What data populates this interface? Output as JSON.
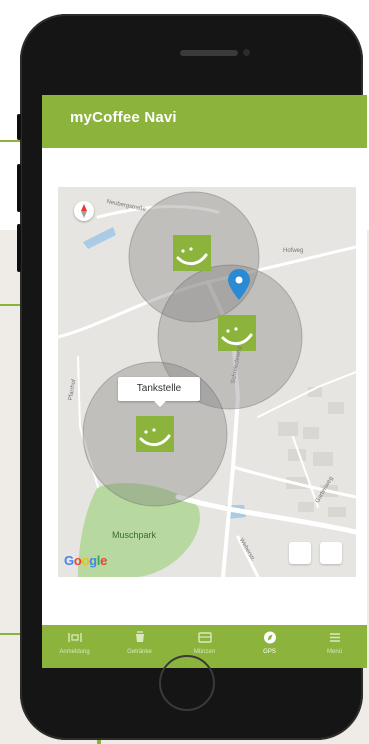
{
  "app": {
    "title": "myCoffee Navi"
  },
  "map": {
    "marker_label": "Tankstelle",
    "park_label": "Muschpark",
    "google_logo": [
      "G",
      "o",
      "o",
      "g",
      "l",
      "e"
    ],
    "google_colors": [
      "#4285f4",
      "#ea4335",
      "#fbbc05",
      "#4285f4",
      "#34a853",
      "#ea4335"
    ],
    "streets": [
      "Neubergstraße",
      "Hofweg",
      "Pfarrhof",
      "Schmiedeweg",
      "Gartenweg",
      "Weberstr."
    ]
  },
  "nav": {
    "items": [
      {
        "label": "Anmeldung",
        "icon": "id-card-icon",
        "active": false
      },
      {
        "label": "Getränke",
        "icon": "cup-icon",
        "active": false
      },
      {
        "label": "Münzen",
        "icon": "wallet-icon",
        "active": false
      },
      {
        "label": "GPS",
        "icon": "compass-icon",
        "active": true
      },
      {
        "label": "Menü",
        "icon": "menu-icon",
        "active": false
      }
    ]
  },
  "colors": {
    "brand": "#8cb43c",
    "pin": "#2a8ad4",
    "marker": "#8cb43c"
  }
}
